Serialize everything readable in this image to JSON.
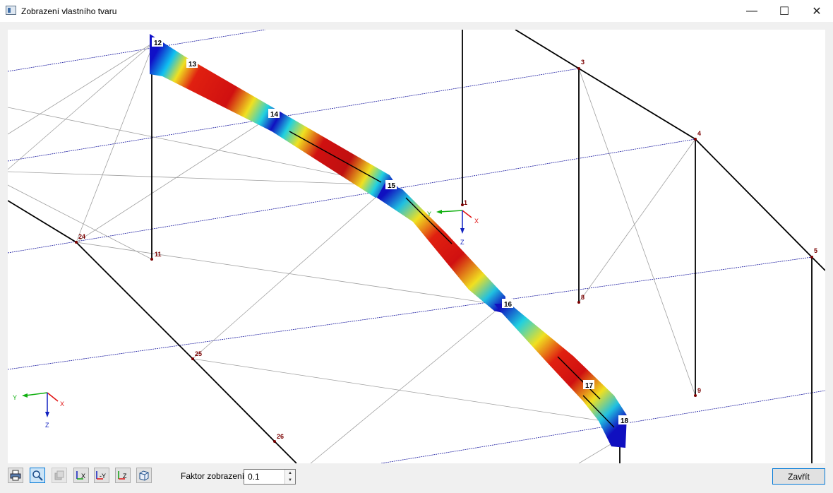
{
  "window": {
    "title": "Zobrazení vlastního tvaru",
    "minimize": "—",
    "maximize": "☐",
    "close": "✕"
  },
  "nodes": [
    "12",
    "13",
    "14",
    "15",
    "16",
    "17",
    "18",
    "1",
    "3",
    "4",
    "5",
    "8",
    "9",
    "11",
    "24",
    "25",
    "26"
  ],
  "axes": {
    "main": {
      "x": "X",
      "y": "Y",
      "z": "Z"
    },
    "corner": {
      "x": "X",
      "y": "Y",
      "z": "Z"
    }
  },
  "colors": {
    "member": "#000000",
    "grid_line": "#1a1aa0",
    "aux_line": "#a0a0a0",
    "node_label": "#7a0000",
    "axis_x": "#e01010",
    "axis_y": "#10b010",
    "axis_z": "#1020c0",
    "accent": "#0078d7"
  },
  "toolbar": {
    "buttons": [
      "print-icon",
      "zoom-icon",
      "render-icon",
      "view-x-icon",
      "view-minus-y-icon",
      "view-z-icon",
      "isometric-icon"
    ],
    "factor_label": "Faktor zobrazení:",
    "factor_value": "0.1",
    "close_label": "Zavřít"
  }
}
